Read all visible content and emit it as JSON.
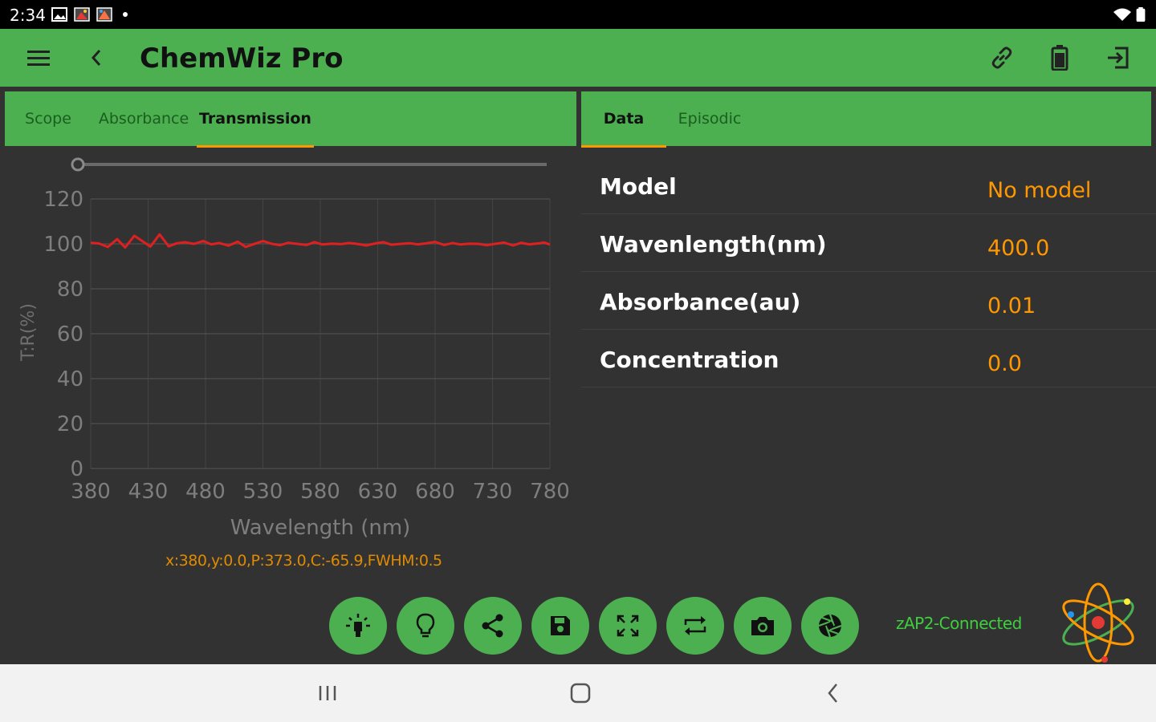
{
  "status_bar": {
    "time": "2:34"
  },
  "app_bar": {
    "title": "ChemWiz Pro"
  },
  "left_tabs": [
    {
      "label": "Scope",
      "active": false
    },
    {
      "label": "Absorbance",
      "active": false
    },
    {
      "label": "Transmission",
      "active": true
    }
  ],
  "right_tabs": [
    {
      "label": "Data",
      "active": true
    },
    {
      "label": "Episodic",
      "active": false
    }
  ],
  "chart_data": {
    "type": "line",
    "xlabel": "Wavelength (nm)",
    "ylabel": "T:R(%)",
    "xlim": [
      380,
      780
    ],
    "ylim": [
      0,
      120
    ],
    "x_ticks": [
      "380",
      "430",
      "480",
      "530",
      "580",
      "630",
      "680",
      "730",
      "780"
    ],
    "y_ticks": [
      "120",
      "100",
      "80",
      "60",
      "40",
      "20",
      "0"
    ],
    "grid": true,
    "series": [
      {
        "color": "#e02020",
        "x": [
          380,
          387,
          395,
          403,
          410,
          418,
          425,
          432,
          440,
          448,
          455,
          462,
          470,
          478,
          485,
          492,
          500,
          508,
          515,
          522,
          530,
          538,
          545,
          552,
          560,
          568,
          575,
          582,
          590,
          598,
          605,
          612,
          620,
          628,
          635,
          642,
          650,
          658,
          665,
          672,
          680,
          688,
          695,
          702,
          710,
          718,
          725,
          732,
          740,
          748,
          755,
          762,
          770,
          775,
          780
        ],
        "y": [
          100.5,
          100.2,
          98.6,
          102.1,
          98.4,
          103.6,
          101.2,
          98.8,
          104.2,
          98.9,
          100.3,
          100.7,
          100.0,
          101.3,
          99.8,
          100.4,
          99.2,
          101.0,
          98.6,
          99.9,
          101.3,
          100.0,
          99.4,
          100.5,
          100.0,
          99.5,
          100.8,
          99.7,
          100.1,
          99.9,
          100.4,
          100.0,
          99.3,
          100.2,
          100.8,
          99.6,
          100.0,
          100.3,
          99.8,
          100.2,
          100.9,
          99.5,
          100.4,
          99.7,
          100.1,
          100.0,
          99.4,
          100.0,
          100.6,
          99.3,
          100.5,
          99.8,
          100.2,
          100.6,
          99.7
        ]
      }
    ],
    "slider_value": 0
  },
  "data_table": [
    {
      "label": "Model",
      "value": "No model"
    },
    {
      "label": "Wavenlength(nm)",
      "value": "400.0"
    },
    {
      "label": "Absorbance(au)",
      "value": "0.01"
    },
    {
      "label": "Concentration",
      "value": "0.0"
    }
  ],
  "readout": "x:380,y:0.0,P:373.0,C:-65.9,FWHM:0.5",
  "connection_status": "zAP2-Connected",
  "actions": [
    "lamp-icon",
    "bulb-icon",
    "share-icon",
    "save-icon",
    "fullscreen-icon",
    "swap-icon",
    "camera-icon",
    "shutter-icon"
  ],
  "colors": {
    "accent": "#4caf50",
    "value": "#ff9800",
    "background": "#323232",
    "trace": "#e02020"
  }
}
